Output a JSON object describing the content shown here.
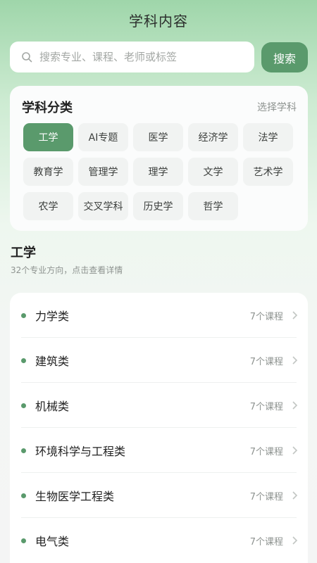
{
  "header": {
    "title": "学科内容"
  },
  "search": {
    "placeholder": "搜索专业、课程、老师或标签",
    "button_label": "搜索"
  },
  "category": {
    "title": "学科分类",
    "select_label": "选择学科",
    "chips": [
      "工学",
      "AI专题",
      "医学",
      "经济学",
      "法学",
      "教育学",
      "管理学",
      "理学",
      "文学",
      "艺术学",
      "农学",
      "交叉学科",
      "历史学",
      "哲学"
    ],
    "active_chip": "工学"
  },
  "section": {
    "title": "工学",
    "subtitle": "32个专业方向，点击查看详情"
  },
  "list": {
    "items": [
      {
        "name": "力学类",
        "count": "7个课程"
      },
      {
        "name": "建筑类",
        "count": "7个课程"
      },
      {
        "name": "机械类",
        "count": "7个课程"
      },
      {
        "name": "环境科学与工程类",
        "count": "7个课程"
      },
      {
        "name": "生物医学工程类",
        "count": "7个课程"
      },
      {
        "name": "电气类",
        "count": "7个课程"
      }
    ]
  },
  "colors": {
    "accent": "#5a9a6c",
    "chip_bg": "#f1f3f2"
  }
}
